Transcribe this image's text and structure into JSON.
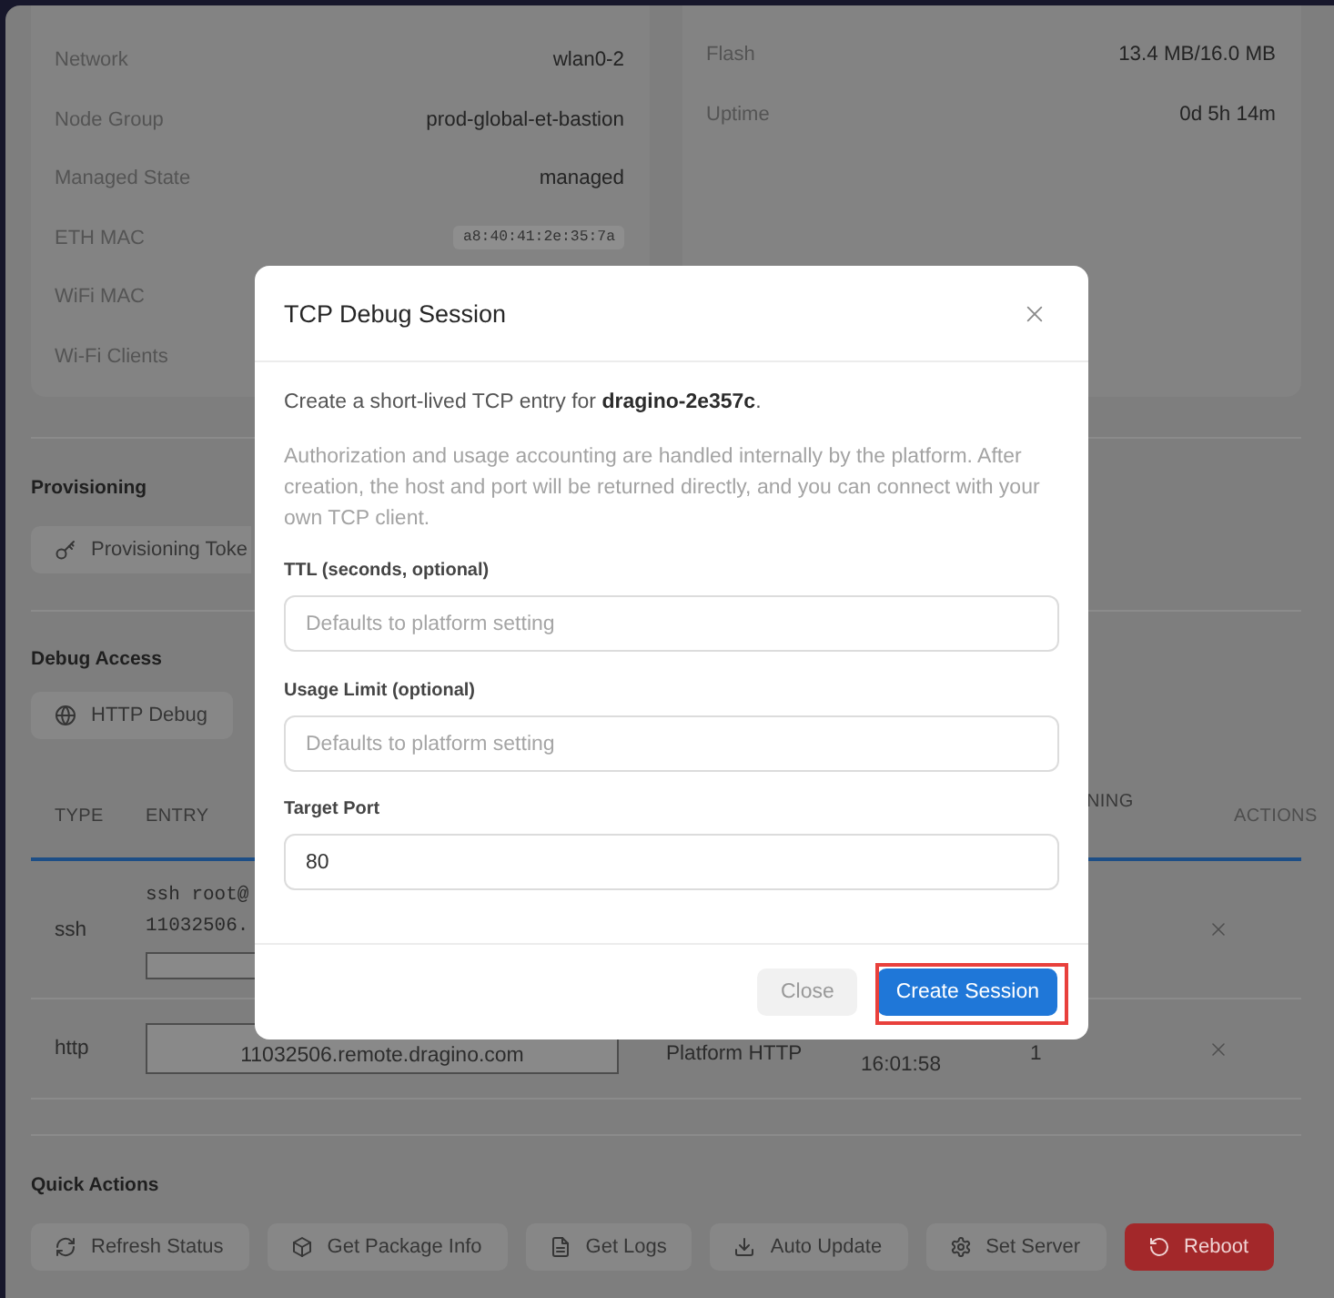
{
  "info": {
    "left": [
      {
        "label": "Network",
        "value": "wlan0-2",
        "kind": "text"
      },
      {
        "label": "Node Group",
        "value": "prod-global-et-bastion",
        "kind": "text"
      },
      {
        "label": "Managed State",
        "value": "managed",
        "kind": "text"
      },
      {
        "label": "ETH MAC",
        "value": "a8:40:41:2e:35:7a",
        "kind": "code"
      },
      {
        "label": "WiFi MAC"
      },
      {
        "label": "Wi-Fi Clients"
      }
    ],
    "right": [
      {
        "label": "Flash",
        "value": "13.4 MB/16.0 MB",
        "kind": "text"
      },
      {
        "label": "Uptime",
        "value": "0d 5h 14m",
        "kind": "text"
      }
    ]
  },
  "provisioning": {
    "title": "Provisioning",
    "buttons": [
      {
        "label": "Provisioning Toke"
      }
    ]
  },
  "debug_access": {
    "title": "Debug Access",
    "buttons": [
      {
        "label": "HTTP Debug"
      }
    ],
    "table": {
      "columns": {
        "type": "TYPE",
        "entry": "ENTRY",
        "column_5": "NING",
        "actions": "ACTIONS"
      },
      "rows": [
        {
          "type": "ssh",
          "entry": {
            "kind": "command",
            "lines": [
              "ssh root@",
              "11032506."
            ]
          }
        },
        {
          "type": "http",
          "entry": {
            "kind": "url",
            "lines": [
              "11032506.remote.dragino.com"
            ]
          },
          "column_3": "Platform HTTP",
          "column_4": "16:01:58",
          "column_5": "1"
        }
      ]
    }
  },
  "quick_actions": {
    "title": "Quick Actions",
    "buttons": [
      {
        "label": "Refresh Status",
        "kind": "default"
      },
      {
        "label": "Get Package Info",
        "kind": "default"
      },
      {
        "label": "Get Logs",
        "kind": "default"
      },
      {
        "label": "Auto Update",
        "kind": "default"
      },
      {
        "label": "Set Server",
        "kind": "default"
      },
      {
        "label": "Reboot",
        "kind": "danger"
      }
    ]
  },
  "dialog": {
    "title": "TCP Debug Session",
    "intro": "Create a short-lived TCP entry for **dragino-2e357c**.",
    "note": "Authorization and usage accounting are handled internally by the platform. After creation, the host and port will be returned directly, and you can connect with your own TCP client.",
    "fields": [
      {
        "label": "TTL (seconds, optional)",
        "placeholder": "Defaults to platform setting"
      },
      {
        "label": "Usage Limit (optional)",
        "placeholder": "Defaults to platform setting"
      },
      {
        "label": "Target Port",
        "value": "80"
      }
    ],
    "buttons": [
      {
        "label": "Close",
        "kind": "secondary",
        "highlighted": false
      },
      {
        "label": "Create Session",
        "kind": "primary",
        "highlighted": true
      }
    ]
  }
}
